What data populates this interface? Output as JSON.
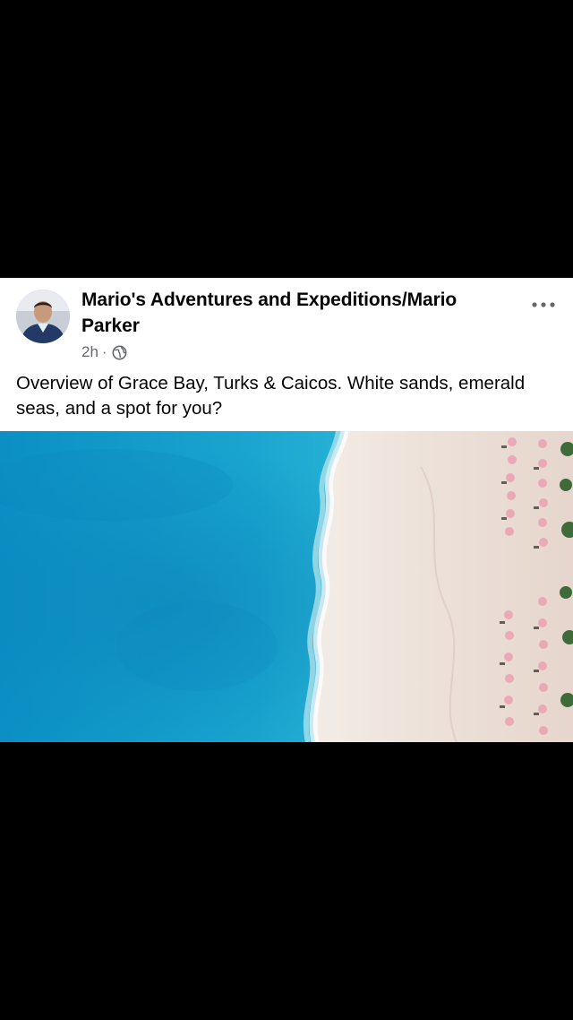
{
  "post": {
    "author": "Mario's Adventures and Expeditions/Mario Parker",
    "timestamp": "2h",
    "separator": "·",
    "audience_icon": "globe-icon",
    "more_icon": "more-options-icon",
    "caption": "Overview of Grace Bay, Turks & Caicos. White sands, emerald seas, and a spot for you?",
    "photo_icon": "aerial-beach-photo"
  },
  "colors": {
    "background": "#000000",
    "card": "#ffffff",
    "text_primary": "#050505",
    "text_secondary": "#65676b",
    "ocean": "#1aa6d0",
    "sand": "#ece0d8",
    "umbrella": "#e9a9b6"
  }
}
